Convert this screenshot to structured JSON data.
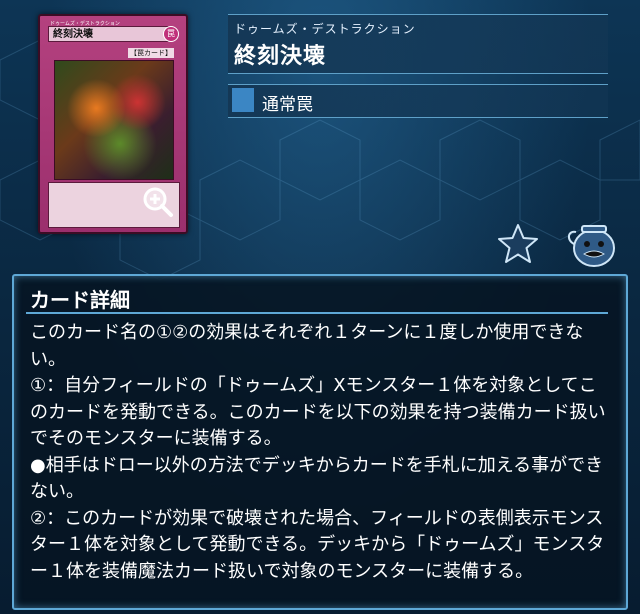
{
  "card": {
    "ruby": "ドゥームズ・デストラクション",
    "name": "終刻決壊",
    "type_label": "通常罠",
    "thumbnail": {
      "name": "終刻決壊",
      "ruby": "ドゥームズ・デストラクション",
      "attribute": "罠",
      "type_tag": "【罠カード】"
    }
  },
  "detail": {
    "title": "カード詳細",
    "text": "このカード名の①②の効果はそれぞれ１ターンに１度しか使用できない。\n①：自分フィールドの「ドゥームズ」Xモンスター１体を対象としてこのカードを発動できる。このカードを以下の効果を持つ装備カード扱いでそのモンスターに装備する。\n●相手はドロー以外の方法でデッキからカードを手札に加える事ができない。\n②：このカードが効果で破壊された場合、フィールドの表側表示モンスター１体を対象として発動できる。デッキから「ドゥームズ」モンスター１体を装備魔法カード扱いで対象のモンスターに装備する。"
  },
  "icons": {
    "zoom": "zoom-in-icon",
    "favorite": "star-icon",
    "deck": "pot-icon"
  },
  "colors": {
    "trap_card": "#b4417f",
    "type_swatch": "#3b86c4",
    "panel_border": "#5ea8d6"
  }
}
